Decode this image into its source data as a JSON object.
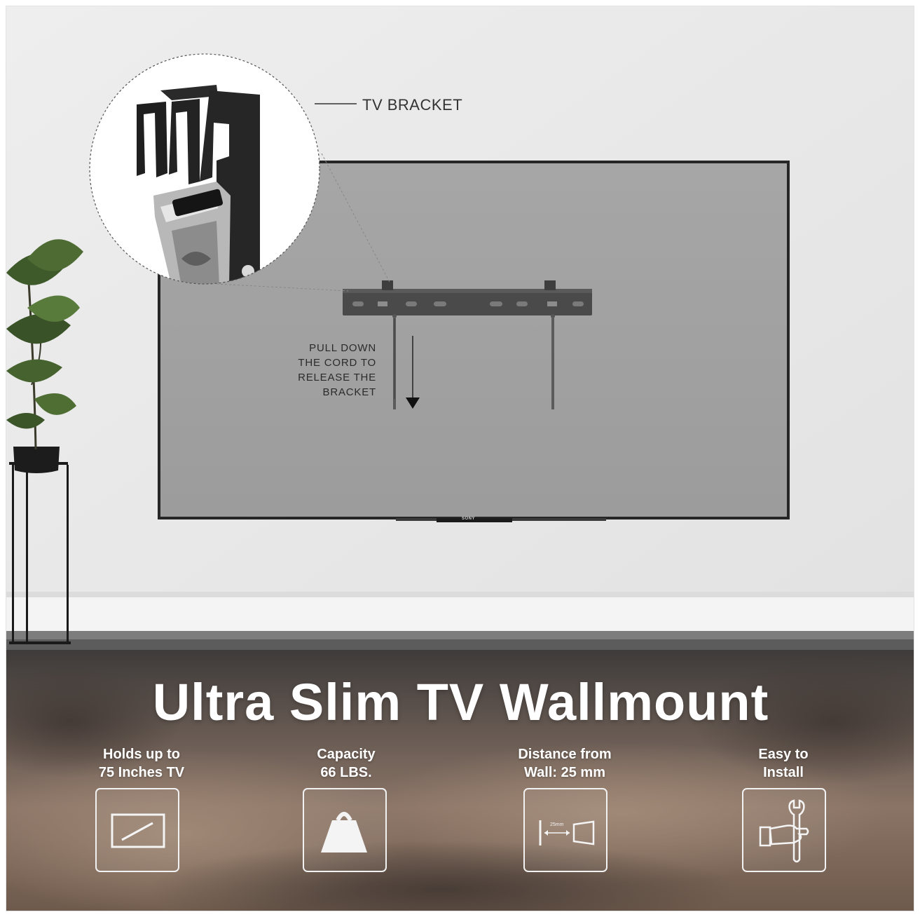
{
  "callout": {
    "bracket_label": "TV BRACKET",
    "pull_label_lines": [
      "PULL DOWN",
      "THE CORD TO",
      "RELEASE THE",
      "BRACKET"
    ]
  },
  "tv": {
    "brand": "SONY"
  },
  "title": "Ultra Slim TV Wallmount",
  "features": [
    {
      "label": "Holds up to\n75 Inches TV",
      "icon": "tv-screen-icon"
    },
    {
      "label": "Capacity\n66 LBS.",
      "icon": "weight-icon"
    },
    {
      "label": "Distance from\nWall: 25 mm",
      "icon": "wall-distance-icon",
      "icon_caption": "25mm"
    },
    {
      "label": "Easy to\nInstall",
      "icon": "wrench-hand-icon"
    }
  ],
  "colors": {
    "wall": "#ebebeb",
    "tv_screen": "#a1a1a1",
    "bracket": "#4d4d4d",
    "footer_band": "#5a4a42"
  }
}
